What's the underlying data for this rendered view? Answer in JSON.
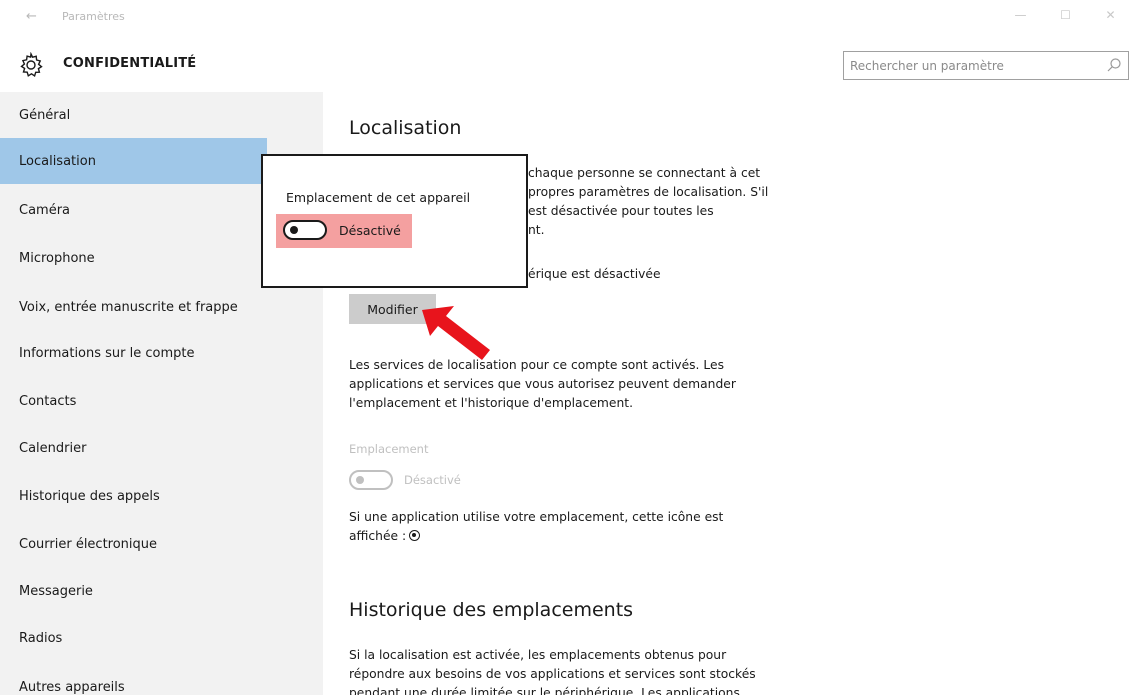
{
  "window": {
    "title": "Paramètres",
    "back_glyph": "←",
    "minimize_glyph": "—",
    "maximize_glyph": "☐",
    "close_glyph": "✕"
  },
  "header": {
    "section_title": "CONFIDENTIALITÉ",
    "search_placeholder": "Rechercher un paramètre"
  },
  "sidebar": {
    "items": [
      {
        "label": "Général"
      },
      {
        "label": "Localisation",
        "active": true
      },
      {
        "label": "Caméra"
      },
      {
        "label": "Microphone"
      },
      {
        "label": "Voix, entrée manuscrite et frappe"
      },
      {
        "label": "Informations sur le compte"
      },
      {
        "label": "Contacts"
      },
      {
        "label": "Calendrier"
      },
      {
        "label": "Historique des appels"
      },
      {
        "label": "Courrier électronique"
      },
      {
        "label": "Messagerie"
      },
      {
        "label": "Radios"
      },
      {
        "label": "Autres appareils"
      }
    ]
  },
  "main": {
    "heading": "Localisation",
    "intro_lines": [
      "chaque personne se connectant à cet",
      "propres paramètres de localisation. S'il",
      "est désactivée pour toutes les",
      "nt."
    ],
    "device_status": "érique est désactivée",
    "modify_button": "Modifier",
    "account_text_1": "Les services de localisation pour ce compte sont activés. Les",
    "account_text_2": "applications et services que vous autorisez peuvent demander",
    "account_text_3": "l'emplacement et l'historique d'emplacement.",
    "location_label": "Emplacement",
    "location_state": "Désactivé",
    "icon_text_1": "Si une application utilise votre emplacement, cette icône est",
    "icon_text_2": "affichée :",
    "history_heading": "Historique des emplacements",
    "history_text_1": "Si la localisation est activée, les emplacements obtenus pour",
    "history_text_2": "répondre aux besoins de vos applications et services sont stockés",
    "history_text_3": "pendant une durée limitée sur le périphérique. Les applications"
  },
  "popup": {
    "label": "Emplacement de cet appareil",
    "state": "Désactivé"
  },
  "colors": {
    "sidebar_bg": "#f2f2f2",
    "active_item": "#9fc7e8",
    "highlight": "#f4a0a0",
    "arrow": "#e8141c"
  }
}
